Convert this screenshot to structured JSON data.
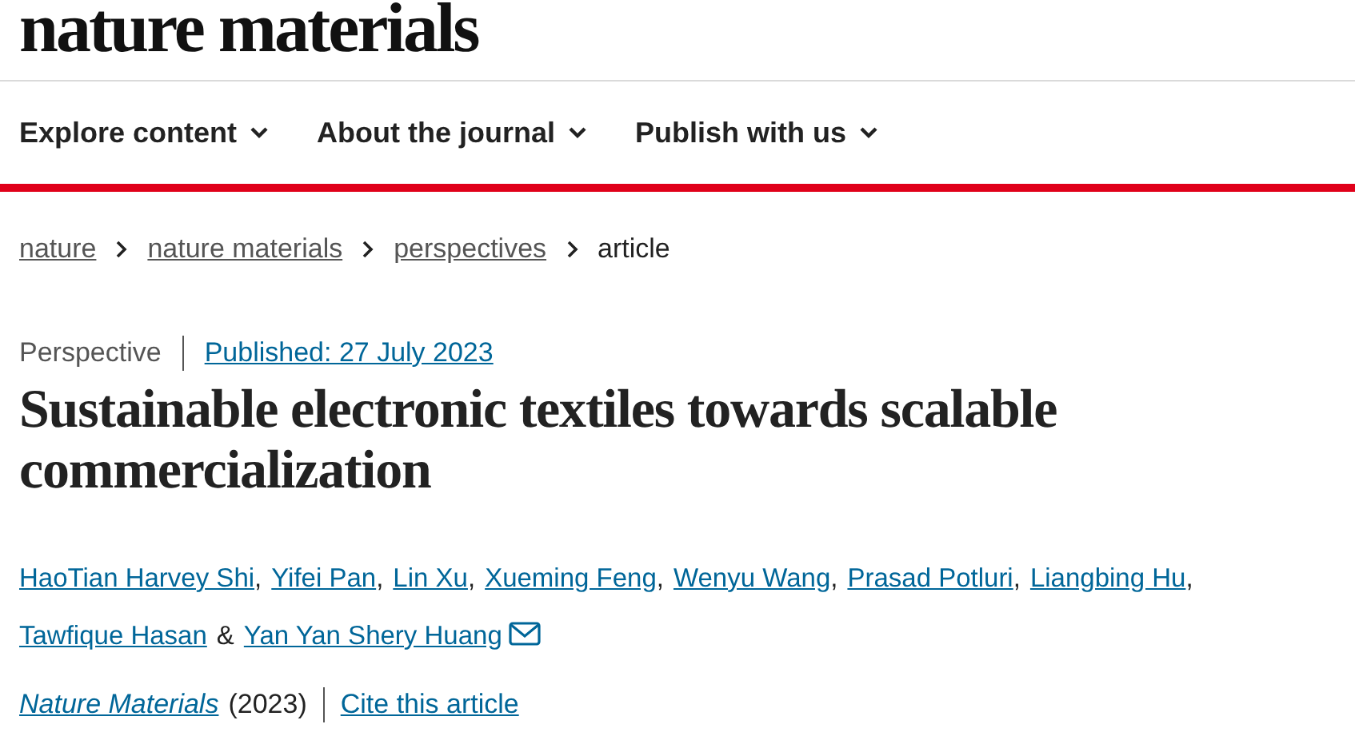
{
  "logo": "nature materials",
  "nav": [
    {
      "label": "Explore content"
    },
    {
      "label": "About the journal"
    },
    {
      "label": "Publish with us"
    }
  ],
  "breadcrumb": [
    {
      "label": "nature",
      "kind": "link"
    },
    {
      "label": "nature materials",
      "kind": "link"
    },
    {
      "label": "perspectives",
      "kind": "link"
    },
    {
      "label": "article",
      "kind": "current"
    }
  ],
  "article": {
    "type": "Perspective",
    "published": "Published: 27 July 2023",
    "title": "Sustainable electronic textiles towards scalable commercialization",
    "authors": [
      {
        "name": "HaoTian Harvey Shi",
        "sep": ",",
        "email": false
      },
      {
        "name": "Yifei Pan",
        "sep": ",",
        "email": false
      },
      {
        "name": "Lin Xu",
        "sep": ",",
        "email": false
      },
      {
        "name": "Xueming Feng",
        "sep": ",",
        "email": false
      },
      {
        "name": "Wenyu Wang",
        "sep": ",",
        "email": false
      },
      {
        "name": "Prasad Potluri",
        "sep": ",",
        "email": false
      },
      {
        "name": "Liangbing Hu",
        "sep": ",",
        "email": false
      },
      {
        "name": "Tawfique Hasan",
        "sep": "&",
        "email": false
      },
      {
        "name": "Yan Yan Shery Huang",
        "email": true
      }
    ],
    "journal": "Nature Materials",
    "year": "(2023)",
    "cite": "Cite this article"
  }
}
